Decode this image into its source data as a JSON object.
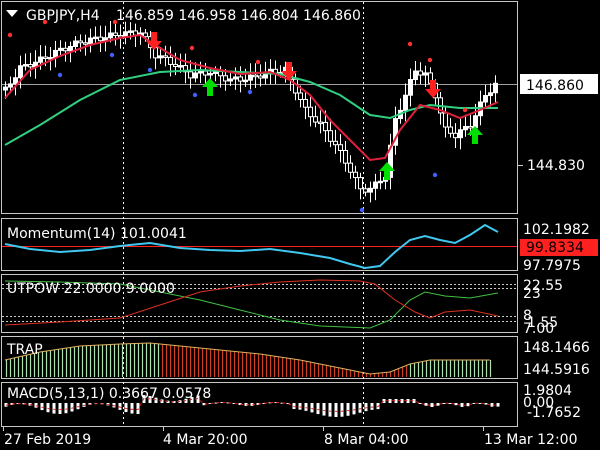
{
  "main": {
    "symbol_title": "GBPJPY,H4",
    "ohlc": "146.859 146.958 146.804 146.860",
    "price_current": "146.860",
    "price_level": "144.830"
  },
  "panels": {
    "momentum": {
      "label": "Momentum(14) 101.0041",
      "ticks": [
        "102.1982",
        "99.8334",
        "97.7975"
      ]
    },
    "utpow": {
      "label": "UTPOW 22.0000 9.0000",
      "ticks": [
        "22.55",
        "23",
        "8",
        "1.55",
        "7.00"
      ]
    },
    "trap": {
      "label": "TRAP",
      "ticks": [
        "148.1466",
        "144.5916"
      ]
    },
    "macd": {
      "label": "MACD(5,13,1) 0.3667 0.0578",
      "ticks": [
        "1.9804",
        "0.00",
        "-1.7652"
      ]
    }
  },
  "time_axis": [
    "27 Feb 2019",
    "4 Mar 20:00",
    "8 Mar 04:00",
    "13 Mar 12:00"
  ],
  "colors": {
    "background": "#000000",
    "frame": "#c8c8c8",
    "candle": "#ffffff",
    "ma_fast": "#e0203a",
    "ma_slow": "#30d080",
    "buy_arrow": "#00e000",
    "sell_arrow": "#ff2020",
    "momentum_line": "#40c8f0",
    "price_level_line": "#ff2020",
    "utpow_green": "#40c040",
    "utpow_red": "#e03020",
    "trap_up": "#b0e0b0",
    "trap_down": "#d04020",
    "trap_line": "#e0b060",
    "macd_hist": "#ffffff",
    "macd_signal": "#e02020"
  }
}
